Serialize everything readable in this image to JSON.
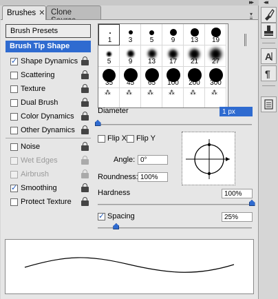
{
  "tabs": [
    {
      "label": "Brushes",
      "active": true
    },
    {
      "label": "Clone Source",
      "active": false
    }
  ],
  "options": {
    "presets_label": "Brush Presets",
    "tip_shape_label": "Brush Tip Shape",
    "items": [
      {
        "label": "Shape Dynamics",
        "checked": true,
        "enabled": true
      },
      {
        "label": "Scattering",
        "checked": false,
        "enabled": true
      },
      {
        "label": "Texture",
        "checked": false,
        "enabled": true
      },
      {
        "label": "Dual Brush",
        "checked": false,
        "enabled": true
      },
      {
        "label": "Color Dynamics",
        "checked": false,
        "enabled": true
      },
      {
        "label": "Other Dynamics",
        "checked": false,
        "enabled": true
      },
      {
        "label": "Noise",
        "checked": false,
        "enabled": true
      },
      {
        "label": "Wet Edges",
        "checked": false,
        "enabled": false
      },
      {
        "label": "Airbrush",
        "checked": false,
        "enabled": false
      },
      {
        "label": "Smoothing",
        "checked": true,
        "enabled": true
      },
      {
        "label": "Protect Texture",
        "checked": false,
        "enabled": true
      }
    ]
  },
  "brushes": {
    "sizes": [
      "1",
      "3",
      "5",
      "9",
      "13",
      "19",
      "5",
      "9",
      "13",
      "17",
      "21",
      "27",
      "35",
      "45",
      "65",
      "100",
      "200",
      "300"
    ],
    "selected_index": 0
  },
  "settings": {
    "diameter_label": "Diameter",
    "diameter_value": "1 px",
    "flip_x_label": "Flip X",
    "flip_y_label": "Flip Y",
    "flip_x": false,
    "flip_y": false,
    "angle_label": "Angle:",
    "angle_value": "0°",
    "roundness_label": "Roundness:",
    "roundness_value": "100%",
    "hardness_label": "Hardness",
    "hardness_value": "100%",
    "hardness_fraction": 1.0,
    "spacing_label": "Spacing",
    "spacing_checked": true,
    "spacing_value": "25%",
    "spacing_fraction": 0.12,
    "diameter_fraction": 0.0
  },
  "colors": {
    "accent": "#2f6bd0",
    "panel_bg": "#e6e6e6"
  },
  "icons": {
    "dock": [
      "brush-tool-icon",
      "clone-stamp-icon",
      "character-panel-icon",
      "paragraph-panel-icon",
      "layer-comps-icon"
    ]
  }
}
